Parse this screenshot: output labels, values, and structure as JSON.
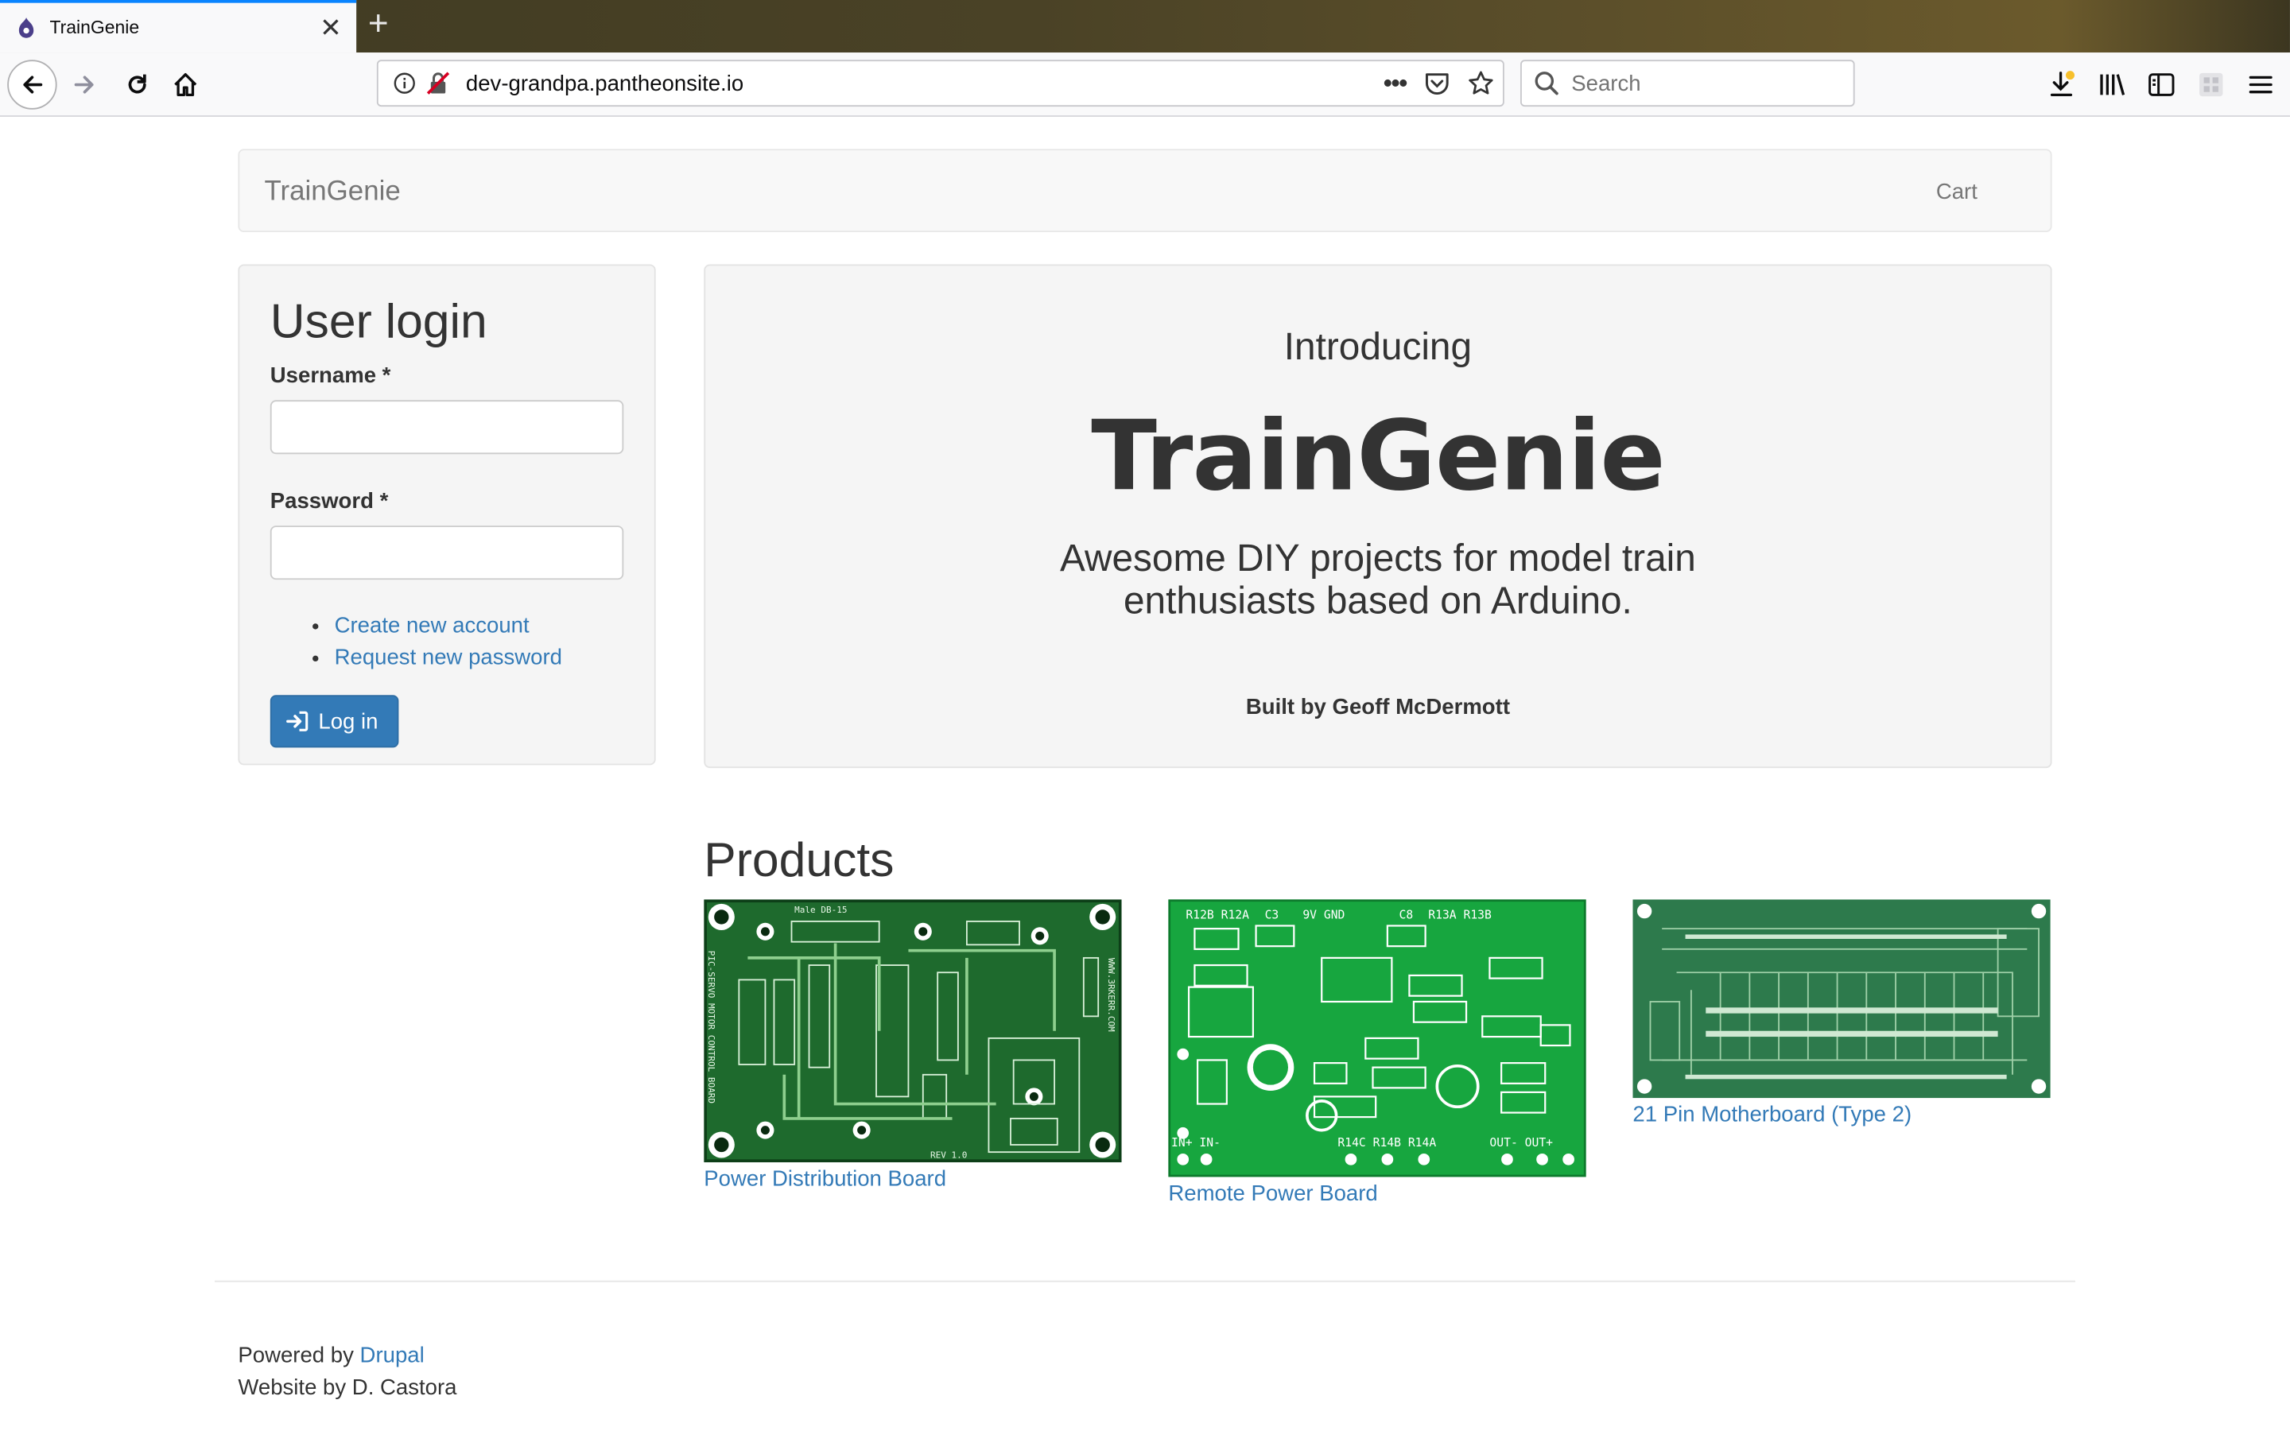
{
  "browser": {
    "tab_title": "TrainGenie",
    "url": "dev-grandpa.pantheonsite.io",
    "search_placeholder": "Search"
  },
  "site": {
    "brand": "TrainGenie",
    "nav_cart": "Cart"
  },
  "login": {
    "title": "User login",
    "username_label": "Username *",
    "password_label": "Password *",
    "links": [
      "Create new account",
      "Request new password"
    ],
    "submit_label": "Log in"
  },
  "hero": {
    "intro": "Introducing",
    "headline": "TrainGenie",
    "tagline": "Awesome DIY projects for model train enthusiasts based on Arduino.",
    "credit": "Built by Geoff McDermott"
  },
  "products": {
    "title": "Products",
    "items": [
      {
        "name": "Power Distribution Board",
        "pcb_labels": [
          "Male DB-15",
          "REV 1.0",
          "WWW.3RKERR.COM",
          "PIC-SERVO MOTOR CONTROL BOARD"
        ]
      },
      {
        "name": "Remote Power Board",
        "pcb_labels": [
          "R12B R12A",
          "C3",
          "9V GND",
          "C8",
          "R13A R13B",
          "R14C R14B R14A",
          "OUT- OUT+",
          "IN+ IN-"
        ]
      },
      {
        "name": "21 Pin Motherboard (Type 2)",
        "pcb_labels": []
      }
    ]
  },
  "footer": {
    "powered_prefix": "Powered by ",
    "powered_link": "Drupal",
    "credit": "Website by D. Castora"
  }
}
